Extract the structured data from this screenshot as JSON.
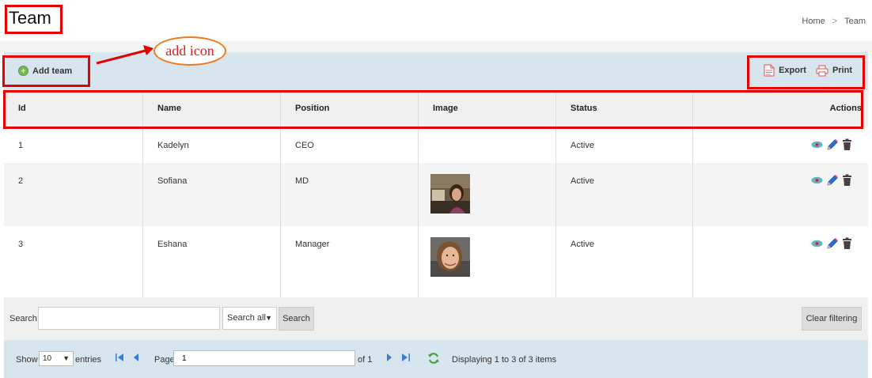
{
  "page": {
    "title": "Team"
  },
  "breadcrumb": {
    "home": "Home",
    "separator": ">",
    "current": "Team"
  },
  "toolbar": {
    "add_label": "Add team",
    "export_label": "Export",
    "print_label": "Print"
  },
  "table": {
    "columns": [
      "Id",
      "Name",
      "Position",
      "Image",
      "Status",
      "Actions"
    ],
    "rows": [
      {
        "id": "1",
        "name": "Kadelyn",
        "position": "CEO",
        "status": "Active",
        "has_image": false
      },
      {
        "id": "2",
        "name": "Sofiana",
        "position": "MD",
        "status": "Active",
        "has_image": true
      },
      {
        "id": "3",
        "name": "Eshana",
        "position": "Manager",
        "status": "Active",
        "has_image": true
      }
    ],
    "action_icons": [
      "eye-icon",
      "pencil-icon",
      "trash-icon"
    ]
  },
  "filter": {
    "search_label": "Search:",
    "search_value": "",
    "scope_value": "Search all",
    "search_button": "Search",
    "clear_button": "Clear filtering"
  },
  "pager": {
    "show_label": "Show",
    "page_size": "10",
    "entries_label": "entries",
    "page_label": "Page",
    "page_value": "1",
    "of_label": "of 1",
    "display_text": "Displaying 1 to 3 of 3 items"
  },
  "annotation": {
    "callout_text": "add icon"
  },
  "colors": {
    "toolbar_bg": "#d7e5ef",
    "header_bg": "#f0f0f0",
    "annotation_red": "#e60000",
    "callout_orange": "#f07a1a",
    "add_green": "#7fb55a",
    "export_red": "#d9534f",
    "eye_teal": "#3aa0b5",
    "pencil_blue": "#2a6ed8",
    "trash_dark": "#4a3f45"
  }
}
